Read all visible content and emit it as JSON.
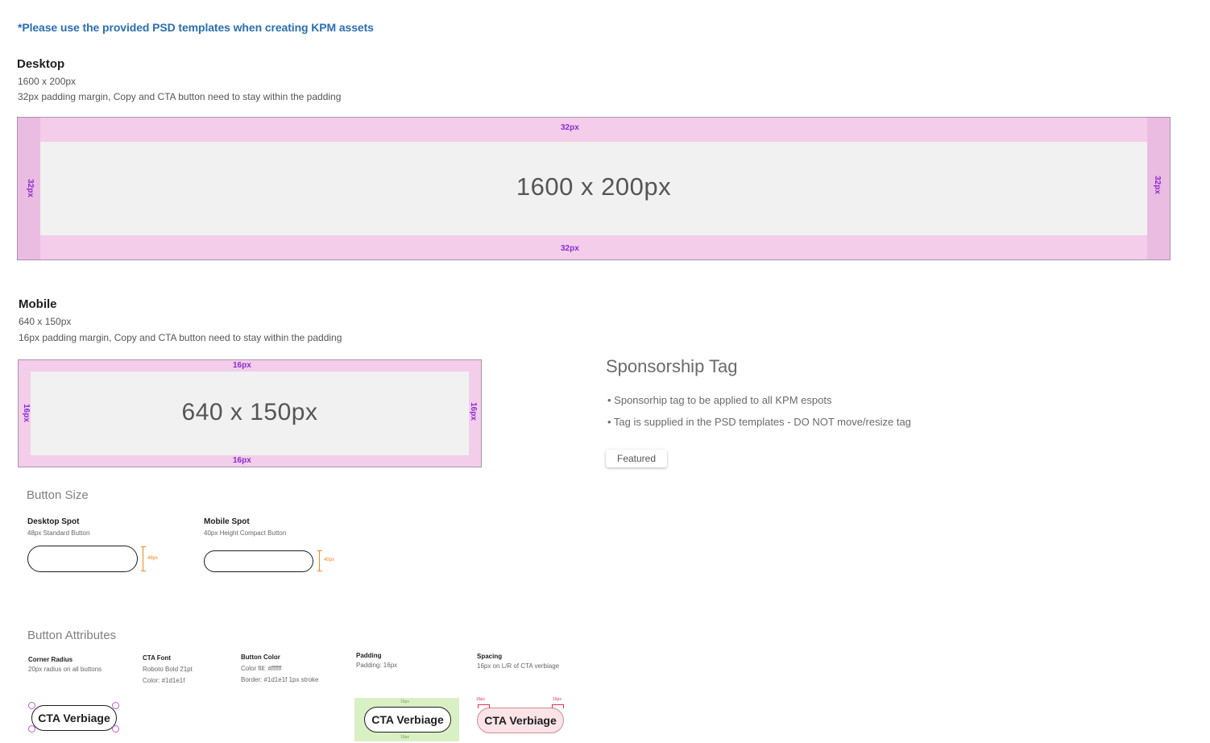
{
  "note": "*Please use the provided PSD templates when creating KPM assets",
  "desktop": {
    "heading": "Desktop",
    "size": "1600 x 200px",
    "description": "32px padding margin, Copy and CTA button need to stay within the padding",
    "box_label": "1600 x 200px",
    "padding_label": "32px"
  },
  "mobile": {
    "heading": "Mobile",
    "size": "640 x 150px",
    "description": "16px padding margin, Copy and CTA button need to stay within the padding",
    "box_label": "640 x 150px",
    "padding_label": "16px"
  },
  "sponsorship": {
    "title": "Sponsorship Tag",
    "bullets": [
      "• Sponsorhip tag to be applied to all KPM espots",
      "• Tag is supplied in the PSD templates - DO NOT move/resize tag"
    ],
    "tag_label": "Featured"
  },
  "button_size": {
    "title": "Button Size",
    "desktop": {
      "label": "Desktop Spot",
      "desc": "48px Standard Button",
      "height_label": "48px"
    },
    "mobile": {
      "label": "Mobile Spot",
      "desc": "40px Height Compact Button",
      "height_label": "40px"
    }
  },
  "button_attributes": {
    "title": "Button Attributes",
    "corner_radius": {
      "label": "Corner Radius",
      "desc": "20px radius on all buttons"
    },
    "cta_font": {
      "label": "CTA Font",
      "line1": "Roboto Bold  21pt",
      "line2": "Color: #1d1e1f"
    },
    "button_color": {
      "label": "Button Color",
      "line1": "Color fill: #ffffff",
      "line2": "Border: #1d1e1f  1px stroke"
    },
    "padding": {
      "label": "Padding",
      "desc": "Padding: 16px",
      "dim_label": "16px"
    },
    "spacing": {
      "label": "Spacing",
      "desc": "16px on L/R of CTA verbiage",
      "dim_label": "16px"
    },
    "cta_text": "CTA Verbiage"
  },
  "colors": {
    "link": "#2a6fb0",
    "padding_pink": "#f3cde9",
    "inner_gray": "#f1f1f1",
    "dim_purple": "#8a2bd0",
    "accent_orange": "#f08a24",
    "padding_green": "#d9f0c4",
    "spacing_red": "#e0344b"
  }
}
